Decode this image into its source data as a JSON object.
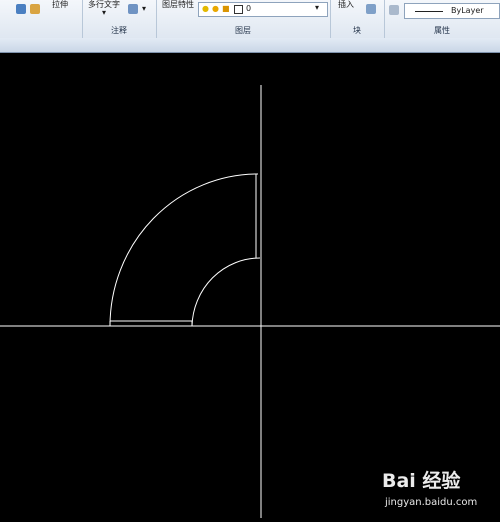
{
  "ribbon": {
    "modify_label": "拉伸",
    "mtext_label": "多行文字",
    "layer_props_label": "图层特性",
    "layer_current": "0",
    "insert_label": "插入",
    "linetype_value": "ByLayer",
    "panels": [
      "注释",
      "图层",
      "块",
      "属性"
    ]
  },
  "canvas": {
    "background": "#000000",
    "line_color": "#ffffff"
  },
  "watermark": {
    "logo": "Bai 经验",
    "url": "jingyan.baidu.com"
  }
}
